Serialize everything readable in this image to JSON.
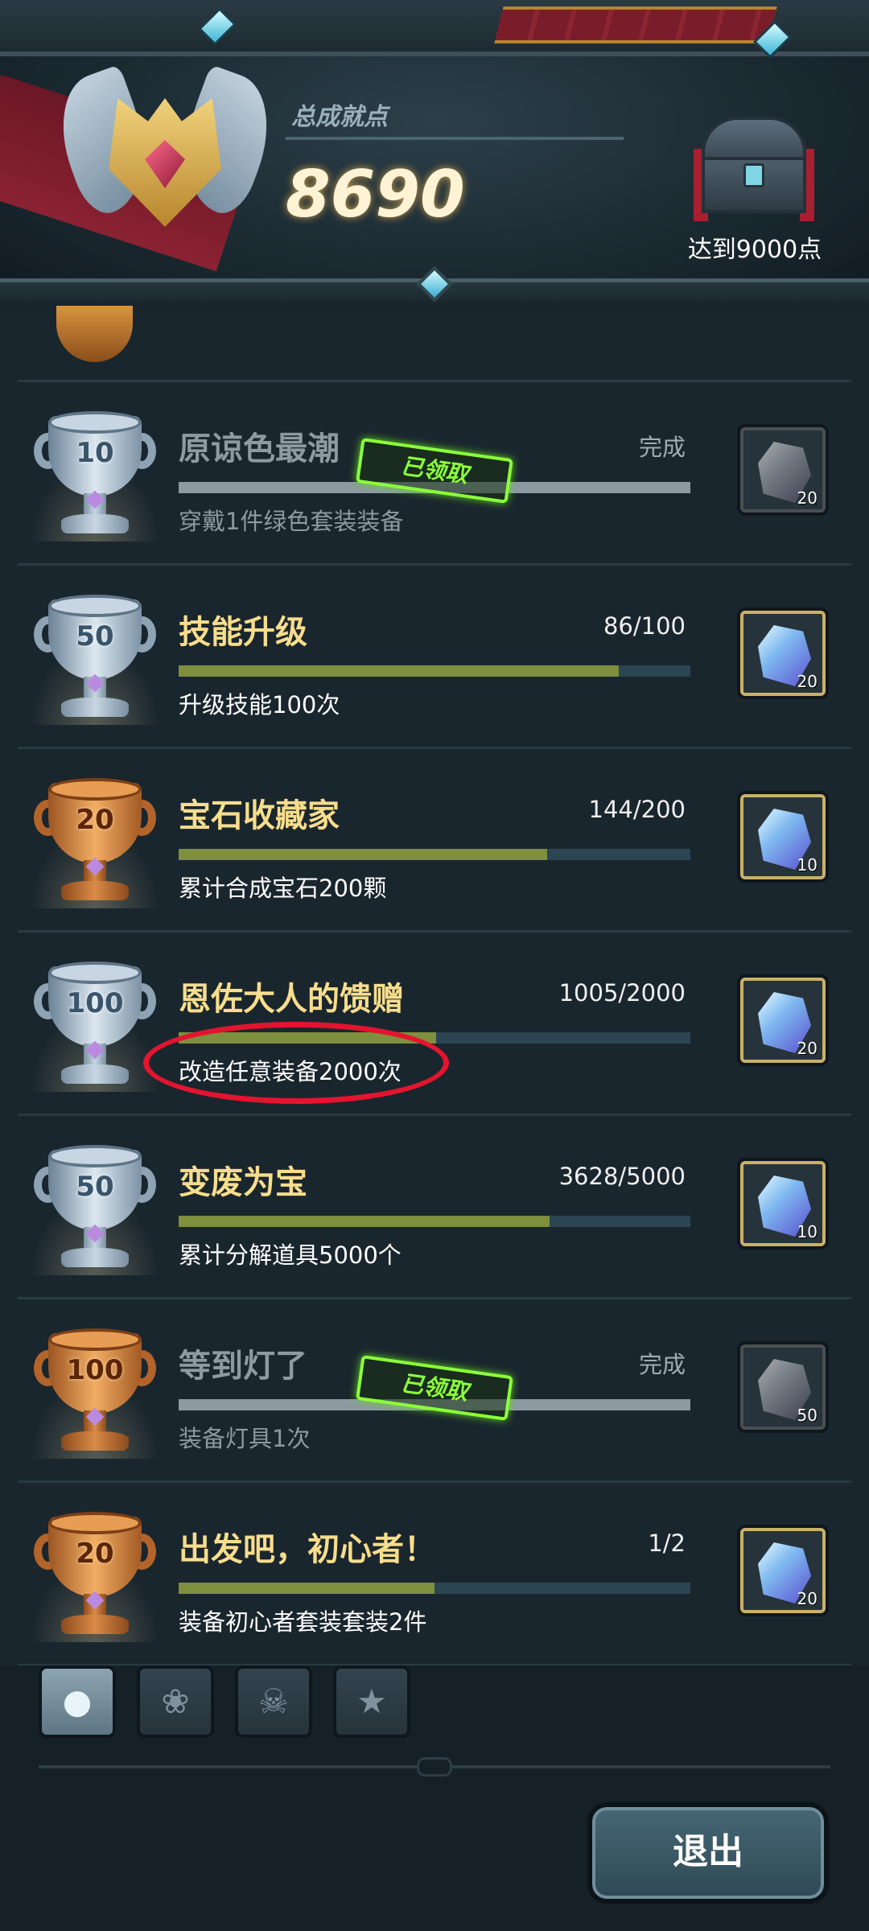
{
  "header": {
    "score_label": "总成就点",
    "score_value": "8690",
    "milestone_label": "达到9000点"
  },
  "achievements": [
    {
      "title": "原谅色最潮",
      "progress": "完成",
      "progress_fraction": 1.0,
      "description": "穿戴1件绿色套装装备",
      "trophy_tier": "silver",
      "trophy_points": "10",
      "claimed": true,
      "claimed_label": "已领取",
      "reward_count": "20"
    },
    {
      "title": "技能升级",
      "progress": "86/100",
      "progress_fraction": 0.86,
      "description": "升级技能100次",
      "trophy_tier": "silver",
      "trophy_points": "50",
      "claimed": false,
      "reward_count": "20"
    },
    {
      "title": "宝石收藏家",
      "progress": "144/200",
      "progress_fraction": 0.72,
      "description": "累计合成宝石200颗",
      "trophy_tier": "bronze",
      "trophy_points": "20",
      "claimed": false,
      "reward_count": "10"
    },
    {
      "title": "恩佐大人的馈赠",
      "progress": "1005/2000",
      "progress_fraction": 0.5025,
      "description": "改造任意装备2000次",
      "trophy_tier": "silver",
      "trophy_points": "100",
      "claimed": false,
      "reward_count": "20"
    },
    {
      "title": "变废为宝",
      "progress": "3628/5000",
      "progress_fraction": 0.7256,
      "description": "累计分解道具5000个",
      "trophy_tier": "silver",
      "trophy_points": "50",
      "claimed": false,
      "reward_count": "10"
    },
    {
      "title": "等到灯了",
      "progress": "完成",
      "progress_fraction": 1.0,
      "description": "装备灯具1次",
      "trophy_tier": "bronze",
      "trophy_points": "100",
      "claimed": true,
      "claimed_label": "已领取",
      "reward_count": "50"
    },
    {
      "title": "出发吧，初心者！",
      "progress": "1/2",
      "progress_fraction": 0.5,
      "description": "装备初心者套装套装2件",
      "trophy_tier": "bronze",
      "trophy_points": "20",
      "claimed": false,
      "reward_count": "20"
    }
  ],
  "tabs": [
    {
      "icon": "head-silhouette-icon",
      "active": true
    },
    {
      "icon": "paw-icon",
      "active": false
    },
    {
      "icon": "demon-mask-icon",
      "active": false
    },
    {
      "icon": "trophy-icon",
      "active": false
    }
  ],
  "footer": {
    "exit_label": "退出"
  },
  "colors": {
    "title_gold": "#f7dd8c",
    "progress_fill": "#7e8f3d",
    "claimed_stamp": "#8bff3a",
    "highlight_ellipse": "#e3142f"
  }
}
